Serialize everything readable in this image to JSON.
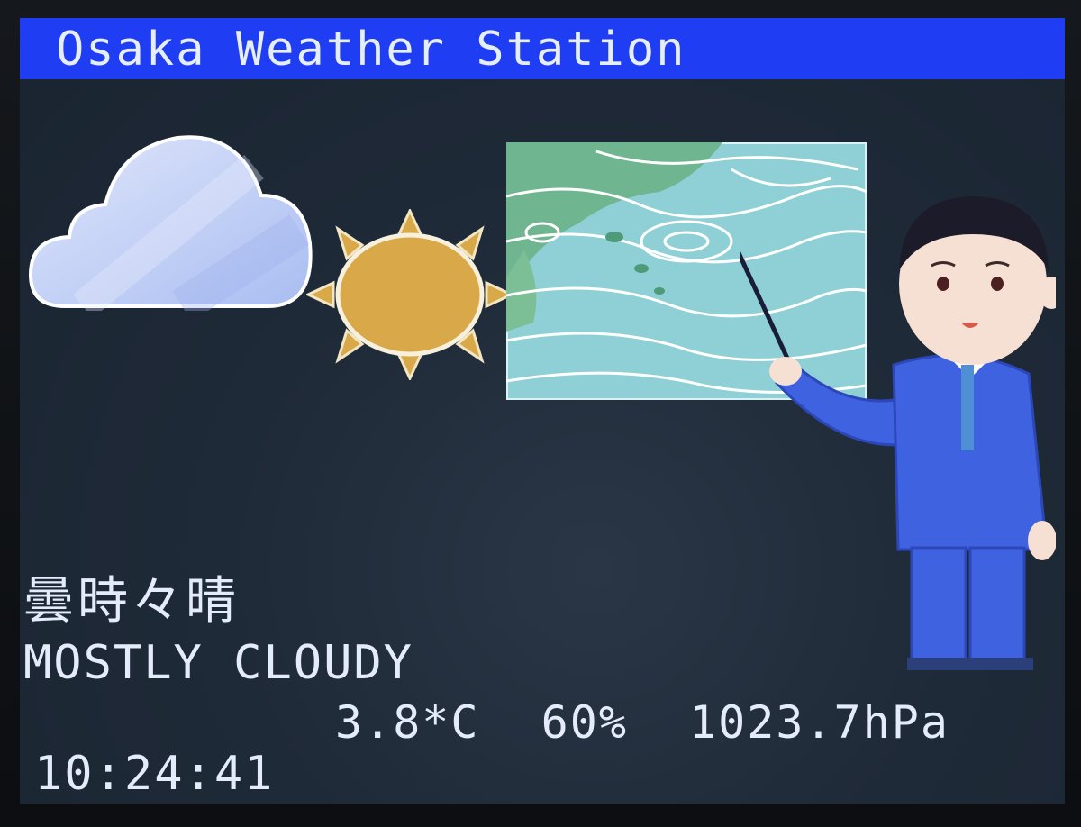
{
  "header": {
    "title": "Osaka Weather Station"
  },
  "forecast": {
    "japanese": "曇時々晴",
    "condition": "MOSTLY CLOUDY"
  },
  "readings": {
    "temperature": "3.8*C",
    "humidity": "60%",
    "pressure": "1023.7hPa"
  },
  "clock": {
    "time": "10:24:41"
  },
  "icons": [
    "cloud-icon",
    "sun-icon",
    "weather-map-image",
    "weather-presenter-illustration"
  ],
  "colors": {
    "titlebar": "#1f3df2",
    "text": "#e4ecfb",
    "sun": "#d9a949",
    "cloud": "#c7d3f7",
    "suit": "#3f63e0"
  }
}
